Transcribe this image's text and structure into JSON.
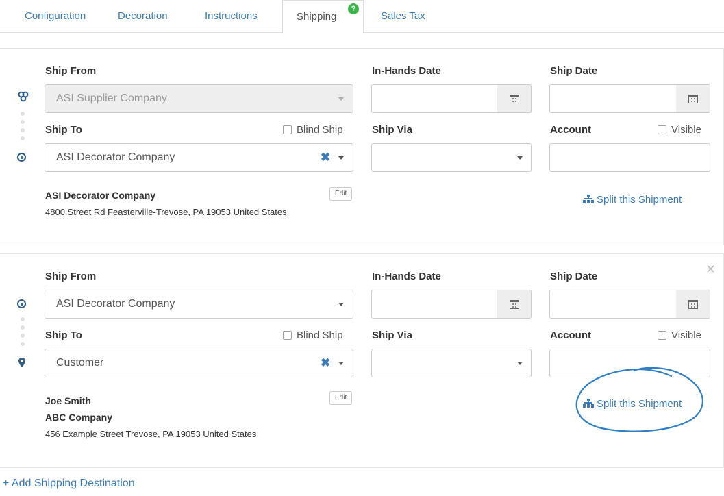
{
  "tabs": [
    {
      "label": "Configuration"
    },
    {
      "label": "Decoration"
    },
    {
      "label": "Instructions"
    },
    {
      "label": "Shipping",
      "badge": "?"
    },
    {
      "label": "Sales Tax"
    }
  ],
  "labels": {
    "ship_from": "Ship From",
    "in_hands_date": "In-Hands Date",
    "ship_date": "Ship Date",
    "ship_to": "Ship To",
    "ship_via": "Ship Via",
    "account": "Account",
    "blind_ship": "Blind Ship",
    "visible": "Visible",
    "edit": "Edit",
    "split": "Split this Shipment"
  },
  "shipments": [
    {
      "ship_from": "ASI Supplier Company",
      "ship_to": "ASI Decorator Company",
      "address": {
        "name": "ASI Decorator Company",
        "line1": "4800 Street Rd Feasterville-Trevose, PA 19053 United States"
      }
    },
    {
      "ship_from": "ASI Decorator Company",
      "ship_to": "Customer",
      "address": {
        "name": "Joe Smith",
        "company": "ABC Company",
        "line1": "456 Example Street Trevose, PA 19053 United States"
      }
    }
  ],
  "add_destination": "+ Add Shipping Destination",
  "colors": {
    "link": "#3a7bb8",
    "badge": "#3bb54a",
    "highlight": "#2f7fc8"
  }
}
